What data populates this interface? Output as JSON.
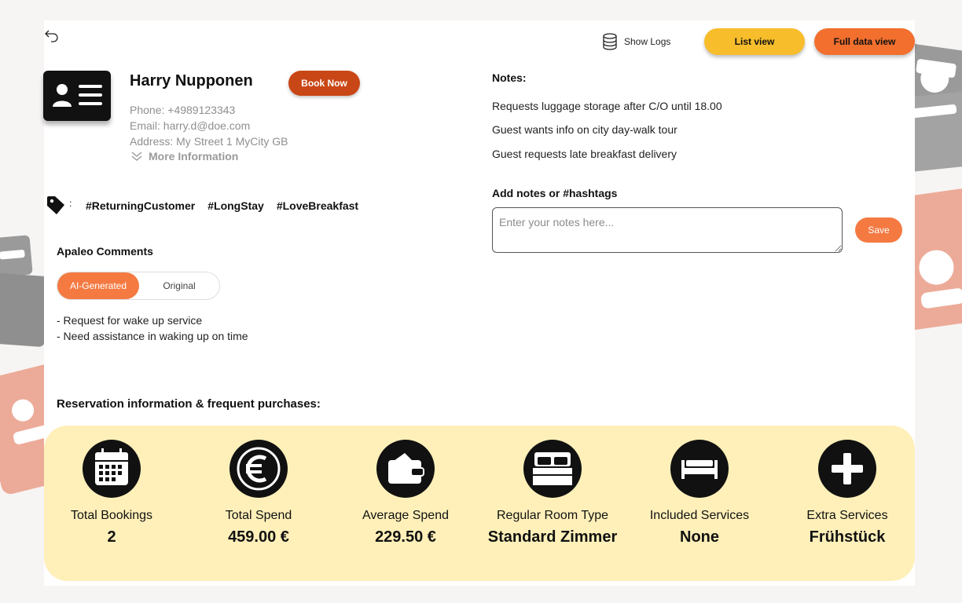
{
  "header": {
    "back_icon": "undo-arrow-icon",
    "show_logs_label": "Show Logs",
    "logs_icon": "database-icon",
    "list_view_label": "List view",
    "full_data_view_label": "Full data view"
  },
  "guest": {
    "name": "Harry Nupponen",
    "book_now_label": "Book Now",
    "phone": "Phone: +4989123343",
    "email": "Email: harry.d@doe.com",
    "address": "Address: My Street 1 MyCity GB",
    "more_information_label": "More Information",
    "card_icon": "id-card-icon"
  },
  "tags": {
    "icon": "tag-icon",
    "separator": ":",
    "items": [
      "#ReturningCustomer",
      "#LongStay",
      "#LoveBreakfast"
    ]
  },
  "apaleo": {
    "title": "Apaleo Comments",
    "toggle": {
      "selected": "AI-Generated",
      "options": [
        "AI-Generated",
        "Original"
      ]
    },
    "comments": [
      "- Request for wake up service",
      "- Need assistance in waking up on time"
    ]
  },
  "notes": {
    "title": "Notes:",
    "items": [
      "Requests luggage storage after C/O until 18.00",
      "Guest wants info on city day-walk tour",
      "Guest requests late breakfast delivery"
    ],
    "add_title": "Add notes or #hashtags",
    "placeholder": "Enter your notes here...",
    "save_label": "Save"
  },
  "reservation": {
    "title": "Reservation information & frequent purchases:",
    "stats": [
      {
        "icon": "calendar-icon",
        "label": "Total Bookings",
        "value": "2"
      },
      {
        "icon": "euro-icon",
        "label": "Total Spend",
        "value": "459.00 €"
      },
      {
        "icon": "wallet-icon",
        "label": "Average Spend",
        "value": "229.50 €"
      },
      {
        "icon": "bed-icon",
        "label": "Regular Room Type",
        "value": "Standard Zimmer"
      },
      {
        "icon": "bed-front-icon",
        "label": "Included Services",
        "value": "None"
      },
      {
        "icon": "plus-icon",
        "label": "Extra Services",
        "value": "Frühstück"
      }
    ]
  },
  "colors": {
    "list_view": "#f7bd2b",
    "full_data_view": "#f26f2e",
    "book_now": "#c94716",
    "accent": "#f47a42",
    "reservation_panel": "#fff0b9"
  }
}
